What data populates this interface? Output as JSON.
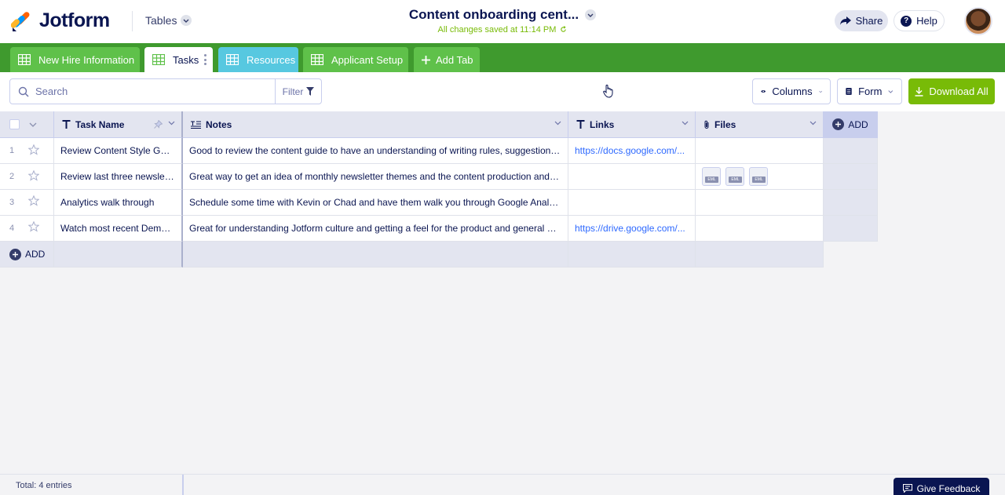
{
  "header": {
    "logo_text": "Jotform",
    "tables_menu": "Tables",
    "title": "Content onboarding cent...",
    "save_status": "All changes saved at 11:14 PM",
    "share_label": "Share",
    "help_label": "Help"
  },
  "tabs": [
    {
      "label": "New Hire Information"
    },
    {
      "label": "Tasks"
    },
    {
      "label": "Resources"
    },
    {
      "label": "Applicant Setup"
    },
    {
      "label": "Add Tab"
    }
  ],
  "toolbar": {
    "search_placeholder": "Search",
    "filter_label": "Filter",
    "columns_label": "Columns",
    "form_label": "Form",
    "download_label": "Download All"
  },
  "table": {
    "columns": [
      {
        "label": "Task Name"
      },
      {
        "label": "Notes"
      },
      {
        "label": "Links"
      },
      {
        "label": "Files"
      }
    ],
    "add_column_label": "ADD",
    "add_row_label": "ADD",
    "rows": [
      {
        "index": "1",
        "task": "Review Content Style Guide",
        "notes": "Good to review the content guide to have an understanding of writing rules, suggestions an...",
        "link": "https://docs.google.com/...",
        "files": []
      },
      {
        "index": "2",
        "task": "Review last three newsletter",
        "notes": "Great way to get an idea of monthly newsletter themes and the content production and kno...",
        "link": "",
        "files": [
          "EML",
          "EML",
          "EML"
        ]
      },
      {
        "index": "3",
        "task": "Analytics walk through",
        "notes": "Schedule some time with Kevin or Chad and have them walk you through Google Analytics ...",
        "link": "",
        "files": []
      },
      {
        "index": "4",
        "task": "Watch most recent Demo ...",
        "notes": "Great for understanding Jotform culture and getting a feel for the product and general wor...",
        "link": "https://drive.google.com/...",
        "files": []
      }
    ]
  },
  "footer": {
    "total": "Total: 4 entries",
    "feedback_label": "Give Feedback"
  },
  "colors": {
    "brand_navy": "#0a1551",
    "tab_bar_green": "#3f9a2e",
    "download_green": "#78bb07",
    "link_blue": "#2e69ff"
  }
}
